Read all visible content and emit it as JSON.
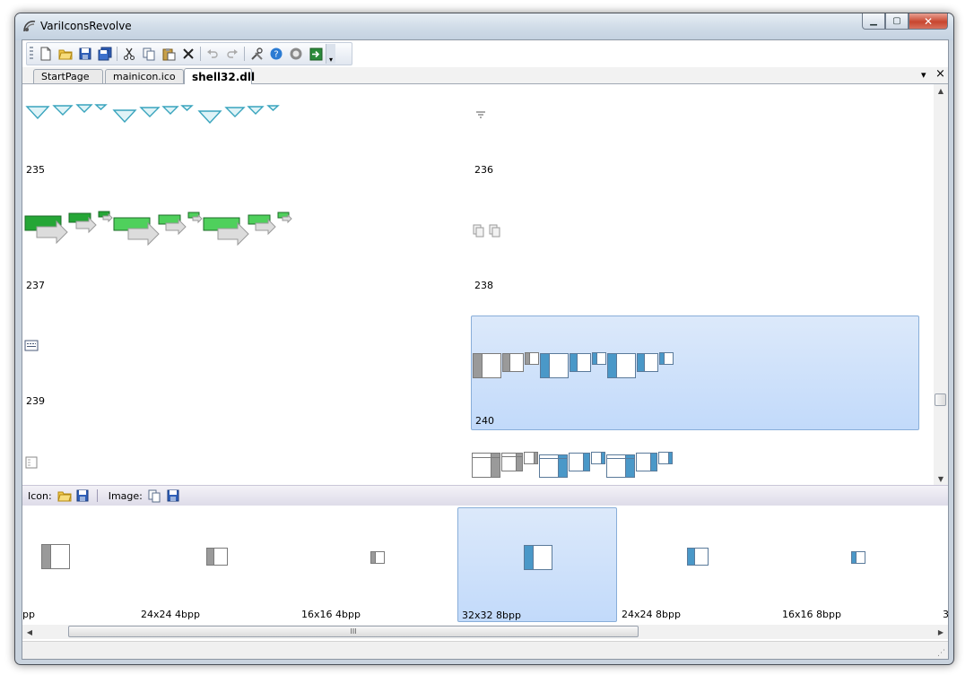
{
  "window": {
    "title": "VariIconsRevolve"
  },
  "caption_buttons": {
    "minimize": "▁",
    "maximize": "▢",
    "close": "✕"
  },
  "toolbar": {
    "items": [
      "new-file-icon",
      "open-folder-icon",
      "save-icon",
      "save-all-icon",
      "cut-icon",
      "copy-icon",
      "paste-icon",
      "delete-icon",
      "undo-icon",
      "redo-icon",
      "tools-icon",
      "help-icon",
      "about-icon",
      "exit-icon"
    ]
  },
  "tabs": [
    {
      "label": "StartPage"
    },
    {
      "label": "mainicon.ico"
    },
    {
      "label": "shell32.dll"
    }
  ],
  "tab_controls": {
    "dropdown": "▾",
    "close": "×"
  },
  "icon_grid": {
    "cells": [
      {
        "label": "235"
      },
      {
        "label": "236"
      },
      {
        "label": "237"
      },
      {
        "label": "238"
      },
      {
        "label": "239"
      },
      {
        "label": "240",
        "selected": true
      },
      {
        "label": ""
      },
      {
        "label": ""
      }
    ]
  },
  "panel_bar": {
    "icon_label": "Icon:",
    "image_label": "Image:"
  },
  "formats": [
    {
      "label": "pp"
    },
    {
      "label": "24x24 4bpp"
    },
    {
      "label": "16x16 4bpp"
    },
    {
      "label": "32x32 8bpp",
      "selected": true
    },
    {
      "label": "24x24 8bpp"
    },
    {
      "label": "16x16 8bpp"
    },
    {
      "label": "3"
    }
  ],
  "hscroll": {
    "thumb_grip": "III"
  },
  "colors": {
    "selection_top": "#dce9fa",
    "selection_bottom": "#c2dafa",
    "selection_border": "#89aed9",
    "accent_blue": "#2b7bd3",
    "green": "#25a636"
  }
}
